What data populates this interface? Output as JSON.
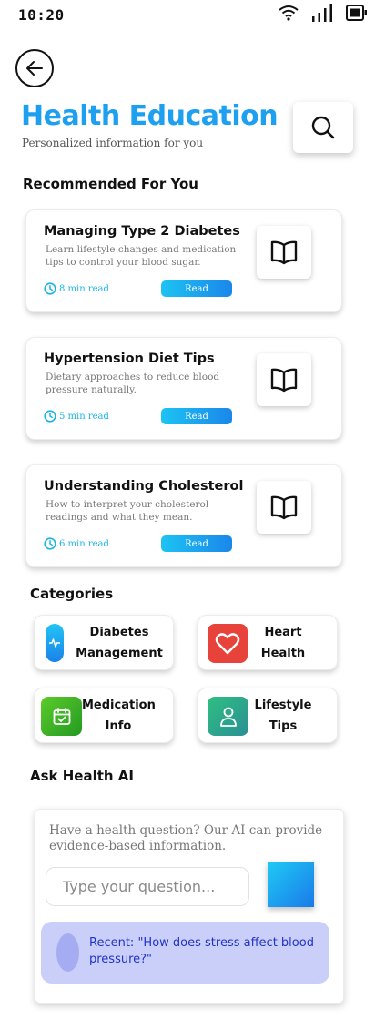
{
  "status_bar": {
    "time": "10:20"
  },
  "header": {
    "title": "Health Education",
    "subtitle": "Personalized information for you"
  },
  "recommended": {
    "heading": "Recommended For You",
    "items": [
      {
        "title": "Managing Type 2 Diabetes",
        "description": "Learn lifestyle changes and medication tips to control your blood sugar.",
        "read_time": "8 min read",
        "button": "Read"
      },
      {
        "title": "Hypertension Diet Tips",
        "description": "Dietary approaches to reduce blood pressure naturally.",
        "read_time": "5 min read",
        "button": "Read"
      },
      {
        "title": "Understanding Cholesterol",
        "description": "How to interpret your cholesterol readings and what they mean.",
        "read_time": "6 min read",
        "button": "Read"
      }
    ]
  },
  "categories": {
    "heading": "Categories",
    "items": [
      {
        "line1": "Diabetes",
        "line2": "Management",
        "icon": "activity-icon",
        "color": "#1a9ff0"
      },
      {
        "line1": "Heart",
        "line2": "Health",
        "icon": "heart-icon",
        "color": "#e8433a"
      },
      {
        "line1": "Medication",
        "line2": "Info",
        "icon": "calendar-check-icon",
        "color": "#3fb52a"
      },
      {
        "line1": "Lifestyle",
        "line2": "Tips",
        "icon": "user-icon",
        "color": "#2aa98a"
      }
    ]
  },
  "ask_ai": {
    "heading": "Ask Health AI",
    "intro": "Have a health question? Our AI can provide evidence-based information.",
    "input_placeholder": "Type your question...",
    "recent": "Recent: \"How does stress affect blood pressure?\""
  },
  "colors": {
    "accent": "#1ea0f0",
    "read_time": "#1cb3e8",
    "recent_bg": "#c9cff8",
    "recent_text": "#2233c8"
  }
}
